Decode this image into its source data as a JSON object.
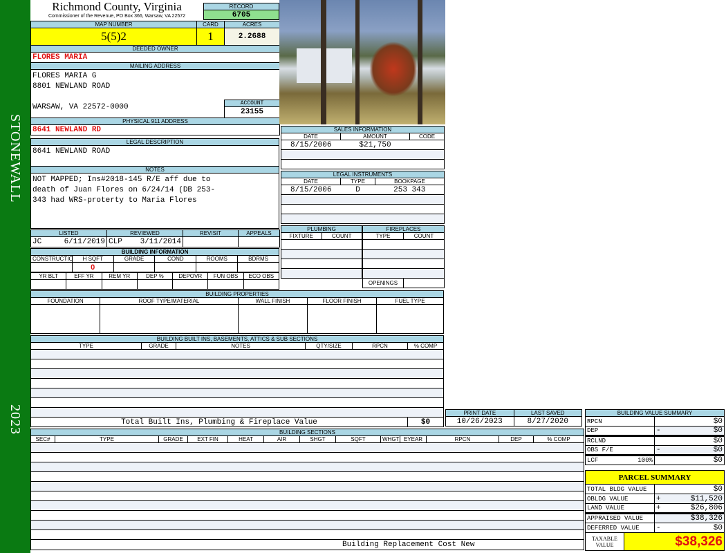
{
  "sidebar": {
    "district": "STONEWALL",
    "year": "2023"
  },
  "header": {
    "county": "Richmond County, Virginia",
    "subtitle": "Commissioner of the Revenue, PO Box 366, Warsaw, VA 22572",
    "record_label": "RECORD",
    "record": "6705"
  },
  "map": {
    "map_label": "MAP NUMBER",
    "map_number": "5(5)2",
    "card_label": "CARD",
    "card": "1",
    "acres_label": "ACRES",
    "acres": "2.2688"
  },
  "owner": {
    "label": "DEEDED OWNER",
    "name": "FLORES MARIA"
  },
  "mailing": {
    "label": "MAILING ADDRESS",
    "line1": "FLORES MARIA G",
    "line2": "8801 NEWLAND ROAD",
    "line3": "WARSAW, VA 22572-0000",
    "account_label": "ACCOUNT",
    "account": "23155"
  },
  "physical": {
    "label": "PHYSICAL 911 ADDRESS",
    "address": "8641 NEWLAND RD"
  },
  "legal": {
    "label": "LEGAL DESCRIPTION",
    "text": "8641 NEWLAND ROAD"
  },
  "notes": {
    "label": "NOTES",
    "line1": "NOT MAPPED; Ins#2018-145 R/E aff due to",
    "line2": "death of Juan Flores on 6/24/14 (DB 253-",
    "line3": "343 had WRS-proterty to Maria Flores"
  },
  "review": {
    "headers": [
      "LISTED",
      "REVIEWED",
      "REVISIT",
      "APPEALS"
    ],
    "listed_by": "JC",
    "listed_date": "6/11/2019",
    "reviewed_by": "CLP",
    "reviewed_date": "3/11/2014"
  },
  "building_info": {
    "label": "BUILDING INFORMATION",
    "headers1": [
      "CONSTRUCTION STYLE",
      "H SQFT",
      "GRADE",
      "COND",
      "ROOMS",
      "BDRMS"
    ],
    "hsqft": "0",
    "headers2": [
      "YR BLT",
      "EFF YR",
      "REM YR",
      "DEP %",
      "DEPOVR",
      "FUN OBS",
      "ECO OBS"
    ]
  },
  "sales": {
    "label": "SALES INFORMATION",
    "headers": [
      "DATE",
      "AMOUNT",
      "CODE"
    ],
    "rows": [
      {
        "date": "8/15/2006",
        "amount": "$21,750",
        "code": ""
      }
    ]
  },
  "instruments": {
    "label": "LEGAL INSTRUMENTS",
    "headers": [
      "DATE",
      "TYPE",
      "BOOKPAGE"
    ],
    "rows": [
      {
        "date": "8/15/2006",
        "type": "D",
        "bookpage": "253 343"
      }
    ]
  },
  "plumbing": {
    "label": "PLUMBING",
    "headers": [
      "FIXTURE",
      "COUNT"
    ]
  },
  "fireplaces": {
    "label": "FIREPLACES",
    "headers": [
      "TYPE",
      "COUNT"
    ],
    "openings": "OPENINGS"
  },
  "properties": {
    "label": "BUILDING PROPERTIES",
    "headers": [
      "FOUNDATION",
      "ROOF TYPE/MATERIAL",
      "WALL FINISH",
      "FLOOR FINISH",
      "FUEL TYPE"
    ]
  },
  "builtins": {
    "label": "BUILDING BUILT INS, BASEMENTS, ATTICS & SUB SECTIONS",
    "headers": [
      "TYPE",
      "GRADE",
      "NOTES",
      "QTY/SIZE",
      "RPCN",
      "% COMP"
    ],
    "total_label": "Total Built Ins, Plumbing & Fireplace Value",
    "total": "$0"
  },
  "dates": {
    "print_label": "PRINT DATE",
    "print_date": "10/26/2023",
    "saved_label": "LAST SAVED",
    "last_saved": "8/27/2020"
  },
  "sections": {
    "label": "BUILDING SECTIONS",
    "headers": [
      "SEC#",
      "TYPE",
      "GRADE",
      "EXT FIN",
      "HEAT",
      "AIR",
      "SHGT",
      "SQFT",
      "WHGT",
      "EYEAR",
      "RPCN",
      "DEP",
      "% COMP"
    ],
    "footer": "Building Replacement Cost New"
  },
  "value_summary": {
    "label": "BUILDING VALUE SUMMARY",
    "rows": [
      {
        "label": "RPCN",
        "op": "",
        "value": "$0"
      },
      {
        "label": "DEP",
        "op": "-",
        "value": "$0"
      },
      {
        "label": "RCLND",
        "op": "",
        "value": "$0"
      },
      {
        "label": "OBS F/E",
        "op": "-",
        "value": "$0"
      },
      {
        "label": "LCF",
        "pct": "100%",
        "op": "",
        "value": "$0"
      }
    ]
  },
  "parcel": {
    "label": "PARCEL SUMMARY",
    "rows": [
      {
        "label": "TOTAL BLDG VALUE",
        "op": "",
        "value": "$0"
      },
      {
        "label": "OBLDG VALUE",
        "op": "+",
        "value": "$11,520"
      },
      {
        "label": "LAND VALUE",
        "op": "+",
        "value": "$26,806"
      },
      {
        "label": "APPRAISED VALUE",
        "op": "",
        "value": "$38,326"
      },
      {
        "label": "DEFERRED VALUE",
        "op": "-",
        "value": "$0"
      }
    ],
    "taxable_label1": "TAXABLE",
    "taxable_label2": "VALUE",
    "taxable": "$38,326"
  }
}
